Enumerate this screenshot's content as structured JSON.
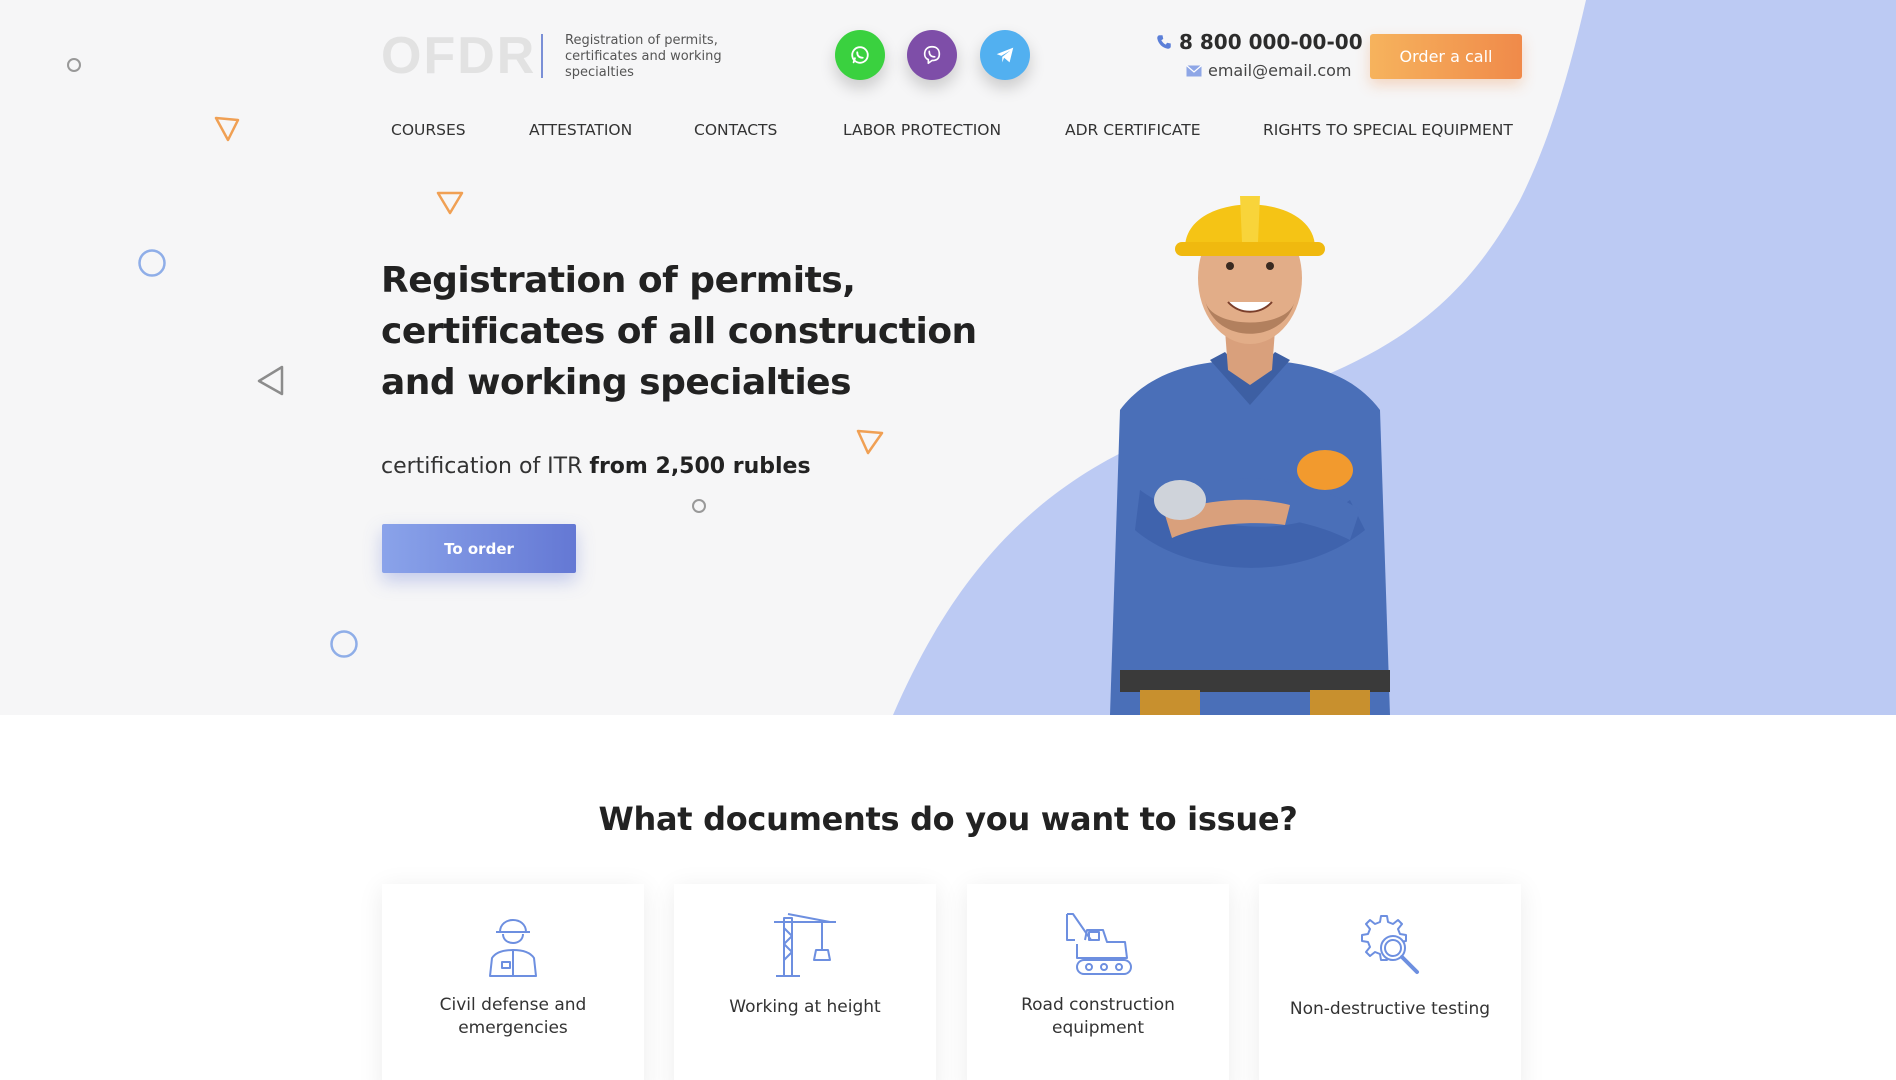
{
  "header": {
    "logo": "OFDR",
    "tagline": "Registration of permits, certificates and working specialties",
    "phone": "8 800 000-00-00",
    "email": "email@email.com",
    "order_call_label": "Order a call"
  },
  "social": [
    {
      "name": "whatsapp-icon"
    },
    {
      "name": "viber-icon"
    },
    {
      "name": "telegram-icon"
    }
  ],
  "nav": [
    {
      "label": "COURSES"
    },
    {
      "label": "ATTESTATION"
    },
    {
      "label": "CONTACTS"
    },
    {
      "label": "LABOR PROTECTION"
    },
    {
      "label": "ADR CERTIFICATE"
    },
    {
      "label": "RIGHTS TO SPECIAL EQUIPMENT"
    }
  ],
  "hero": {
    "title": "Registration of permits, certificates of all construction and working specialties",
    "subtitle_prefix": "certification of ITR ",
    "subtitle_price": "from 2,500 rubles",
    "button_label": "To order"
  },
  "documents": {
    "title": "What documents do you want to issue?",
    "cards": [
      {
        "label": "Civil defense and emergencies",
        "icon": "worker-helmet-icon"
      },
      {
        "label": "Working at height",
        "icon": "crane-icon"
      },
      {
        "label": "Road construction equipment",
        "icon": "excavator-icon"
      },
      {
        "label": "Non-destructive testing",
        "icon": "gear-magnifier-icon"
      }
    ]
  },
  "colors": {
    "accent_blue": "#bccaf3",
    "button_blue": "#7189de",
    "button_orange": "#f39b52",
    "hero_bg": "#f6f6f7"
  }
}
